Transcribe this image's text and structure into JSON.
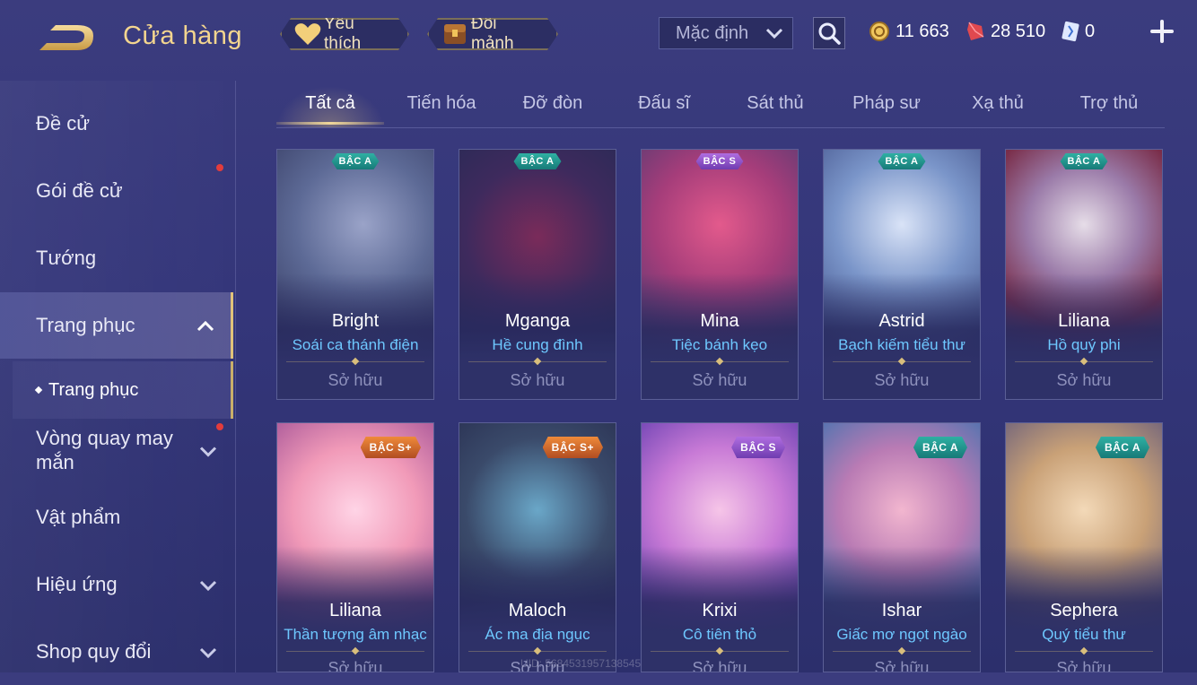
{
  "header": {
    "title": "Cửa hàng",
    "favorite_label": "Yêu thích",
    "exchange_label": "Đổi mảnh",
    "sort_value": "Mặc định",
    "currencies": [
      {
        "icon": "gold-coin-icon",
        "amount": "11 663"
      },
      {
        "icon": "ruby-voucher-icon",
        "amount": "28 510"
      },
      {
        "icon": "skin-card-icon",
        "amount": "0"
      }
    ]
  },
  "sidebar": {
    "items": [
      {
        "label": "Đề cử"
      },
      {
        "label": "Gói đề cử"
      },
      {
        "label": "Tướng"
      },
      {
        "label": "Trang phục"
      },
      {
        "label": "Vòng quay may mắn"
      },
      {
        "label": "Vật phẩm"
      },
      {
        "label": "Hiệu ứng"
      },
      {
        "label": "Shop quy đổi"
      }
    ],
    "sub_item": "Trang phục"
  },
  "tabs": [
    {
      "label": "Tất cả"
    },
    {
      "label": "Tiến hóa"
    },
    {
      "label": "Đỡ đòn"
    },
    {
      "label": "Đấu sĩ"
    },
    {
      "label": "Sát thủ"
    },
    {
      "label": "Pháp sư"
    },
    {
      "label": "Xạ thủ"
    },
    {
      "label": "Trợ thủ"
    }
  ],
  "cards": [
    {
      "hero": "Bright",
      "skin": "Soái ca thánh điện",
      "status": "Sở hữu",
      "tier": "BẬC A"
    },
    {
      "hero": "Mganga",
      "skin": "Hề cung đình",
      "status": "Sở hữu",
      "tier": "BẬC A"
    },
    {
      "hero": "Mina",
      "skin": "Tiệc bánh kẹo",
      "status": "Sở hữu",
      "tier": "BẬC S"
    },
    {
      "hero": "Astrid",
      "skin": "Bạch kiếm tiểu thư",
      "status": "Sở hữu",
      "tier": "BẬC A"
    },
    {
      "hero": "Liliana",
      "skin": "Hồ quý phi",
      "status": "Sở hữu",
      "tier": "BẬC A"
    },
    {
      "hero": "Liliana",
      "skin": "Thần tượng âm nhạc",
      "status": "Sở hữu",
      "tier": "BẬC S+"
    },
    {
      "hero": "Maloch",
      "skin": "Ác ma địa ngục",
      "status": "Sở hữu",
      "tier": "BẬC S+"
    },
    {
      "hero": "Krixi",
      "skin": "Cô tiên thỏ",
      "status": "Sở hữu",
      "tier": "BẬC S"
    },
    {
      "hero": "Ishar",
      "skin": "Giấc mơ ngọt ngào",
      "status": "Sở hữu",
      "tier": "BẬC A"
    },
    {
      "hero": "Sephera",
      "skin": "Quý tiểu thư",
      "status": "Sở hữu",
      "tier": "BẬC A"
    }
  ],
  "watermark": "UID: 5684531957138545",
  "colors": {
    "accent_gold": "#e0c27a",
    "skin_name_blue": "#6ec8ff",
    "notification_red": "#e33c3c"
  }
}
